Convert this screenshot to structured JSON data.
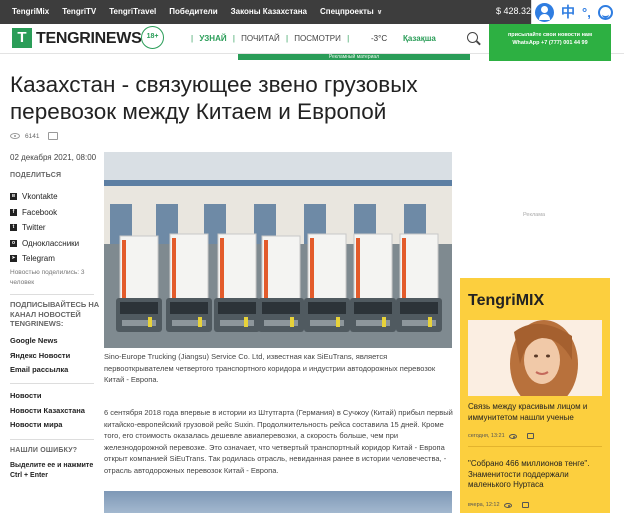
{
  "topbar": {
    "nav": [
      "TengriMix",
      "TengriTV",
      "TengriTravel",
      "Победители",
      "Законы Казахстана",
      "Спецпроекты"
    ],
    "currency": "$ 428.32"
  },
  "extension": {
    "lang_glyph": "中",
    "dots": "°,"
  },
  "header": {
    "logo_letter": "T",
    "logo_text": "TENGRINEWS",
    "age_badge": "18+",
    "nav": [
      "УЗНАЙ",
      "ПОЧИТАЙ",
      "ПОСМОТРИ"
    ],
    "nav_sep": "|",
    "temperature": "-3°C",
    "city": "Қазақша"
  },
  "whatsapp_banner": {
    "line1": "присылайте свои новости нам",
    "line2": "WhatsApp +7 (777) 001 44 99"
  },
  "ad_strip": "Рекламный материал",
  "article": {
    "title": "Казахстан - связующее звено грузовых перевозок между Китаем и Европой",
    "views": "6141",
    "comments": "",
    "date": "02 декабря 2021, 08:00",
    "caption": "Sino-Europe Trucking (Jiangsu) Service Co. Ltd, известная как SiEuTrans, является первооткрывателем четвертого транспортного коридора и индустрии автодорожных перевозок Китай - Европа.",
    "paragraph": "6 сентября 2018 года впервые в истории из Штутгарта (Германия) в Сучжоу (Китай) прибыл первый китайско-европейский грузовой рейс Suxin. Продолжительность рейса составила 15 дней. Кроме того, его стоимость оказалась дешевле авиаперевозки, а скорость больше, чем при железнодорожной перевозке. Это означает, что четвертый транспортный коридор Китай - Европа открыт компанией SiEuTrans. Так родилась отрасль, невиданная ранее в истории человечества, - отрасль автодорожных перевозок Китай - Европа."
  },
  "sidebar": {
    "share_title": "ПОДЕЛИТЬСЯ",
    "share": [
      {
        "icon": "vk",
        "label": "Vkontakte"
      },
      {
        "icon": "f",
        "label": "Facebook"
      },
      {
        "icon": "t",
        "label": "Twitter"
      },
      {
        "icon": "ok",
        "label": "Одноклассники"
      },
      {
        "icon": "tg",
        "label": "Telegram"
      }
    ],
    "shared_note": "Новостью поделились: 3 человек",
    "subscribe_title": "ПОДПИСЫВАЙТЕСЬ НА КАНАЛ НОВОСТЕЙ TENGRINEWS:",
    "subscribe_links": [
      "Google News",
      "Яндекс Новости",
      "Email рассылка"
    ],
    "news_links": [
      "Новости",
      "Новости Казахстана",
      "Новости мира"
    ],
    "error_title": "НАШЛИ ОШИБКУ?",
    "error_text": "Выделите ее и нажмите Ctrl + Enter"
  },
  "right": {
    "ad_label": "Реклама",
    "mix_title": "TengriMIX",
    "items": [
      {
        "title": "Связь между красивым лицом и иммунитетом нашли ученые",
        "time": "сегодня, 13:21",
        "views": "",
        "comments": ""
      },
      {
        "title": "\"Собрано 466 миллионов тенге\". Знаменитости поддержали маленького Нуртаса",
        "time": "вчера, 12:12",
        "views": "",
        "comments": ""
      }
    ]
  }
}
